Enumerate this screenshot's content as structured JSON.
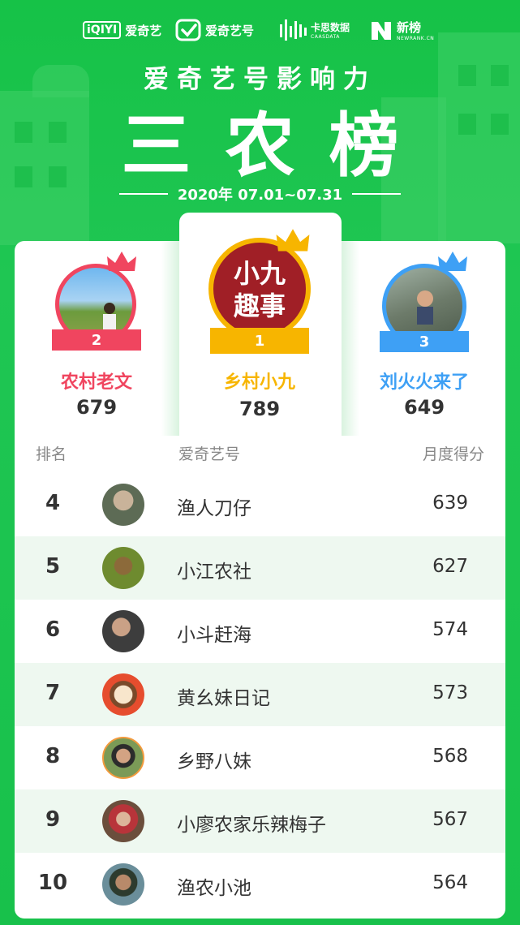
{
  "logos": {
    "iqiyi": {
      "mark": "iQIYI",
      "label": "爱奇艺"
    },
    "iqiyihao": {
      "label": "爱奇艺号"
    },
    "caasdata": {
      "label": "卡思数据",
      "sub": "CAASDATA"
    },
    "newrank": {
      "label": "新榜",
      "sub": "NEWRANK.CN"
    }
  },
  "header": {
    "subtitle": "爱奇艺号影响力",
    "title": "三农榜",
    "date_range": "2020年 07.01~07.31"
  },
  "podium": [
    {
      "rank": "2",
      "name": "农村老文",
      "score": "679",
      "color": "#f0455f"
    },
    {
      "rank": "1",
      "name": "乡村小九",
      "score": "789",
      "color": "#f7b500",
      "avatar_text": "小九 趣事"
    },
    {
      "rank": "3",
      "name": "刘火火来了",
      "score": "649",
      "color": "#3ea0f5"
    }
  ],
  "table": {
    "headers": {
      "rank": "排名",
      "account": "爱奇艺号",
      "score": "月度得分"
    },
    "rows": [
      {
        "rank": "4",
        "name": "渔人刀仔",
        "score": "639"
      },
      {
        "rank": "5",
        "name": "小江农社",
        "score": "627"
      },
      {
        "rank": "6",
        "name": "小斗赶海",
        "score": "574"
      },
      {
        "rank": "7",
        "name": "黄幺妹日记",
        "score": "573"
      },
      {
        "rank": "8",
        "name": "乡野八妹",
        "score": "568"
      },
      {
        "rank": "9",
        "name": "小廖农家乐辣梅子",
        "score": "567"
      },
      {
        "rank": "10",
        "name": "渔农小池",
        "score": "564"
      }
    ]
  },
  "colors": {
    "background": "#17c14a",
    "row_alt": "#eef8f0"
  }
}
